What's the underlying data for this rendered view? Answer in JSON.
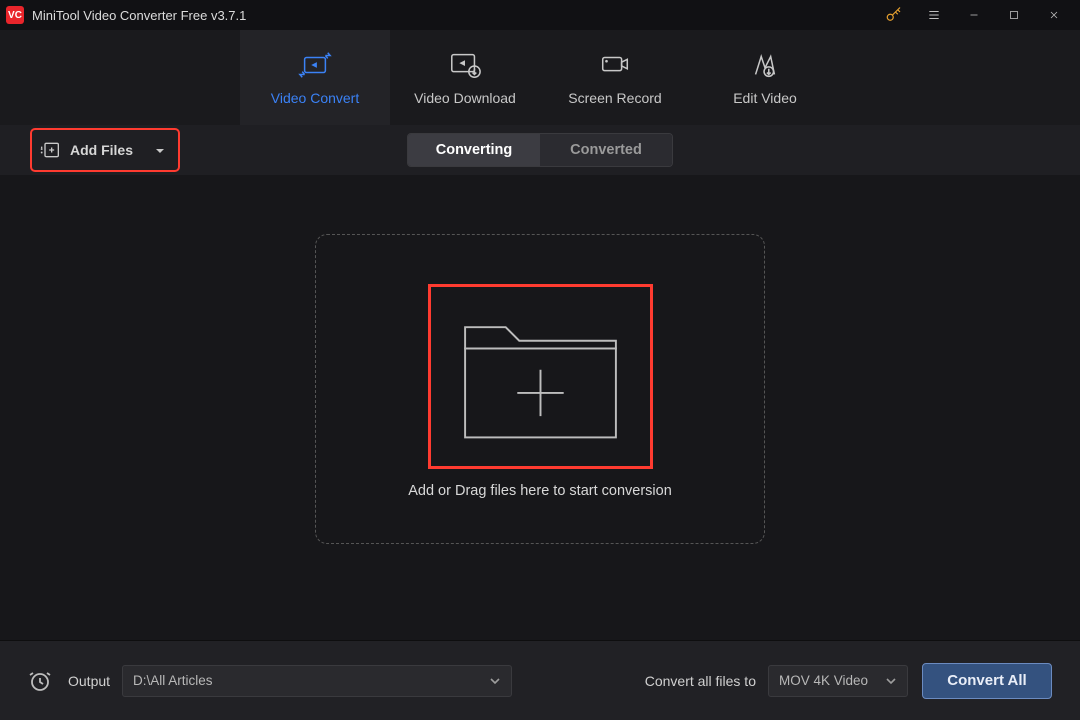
{
  "titlebar": {
    "app_short": "VC",
    "title": "MiniTool Video Converter Free v3.7.1"
  },
  "nav": {
    "tabs": [
      {
        "label": "Video Convert"
      },
      {
        "label": "Video Download"
      },
      {
        "label": "Screen Record"
      },
      {
        "label": "Edit Video"
      }
    ]
  },
  "toolbar": {
    "add_files_label": "Add Files",
    "segments": {
      "converting": "Converting",
      "converted": "Converted"
    }
  },
  "dropzone": {
    "hint": "Add or Drag files here to start conversion"
  },
  "footer": {
    "output_label": "Output",
    "output_path": "D:\\All Articles",
    "convert_all_to_label": "Convert all files to",
    "format_selected": "MOV 4K Video",
    "convert_all_button": "Convert All"
  },
  "highlights": {
    "add_files_box": true,
    "dropzone_box": true
  }
}
